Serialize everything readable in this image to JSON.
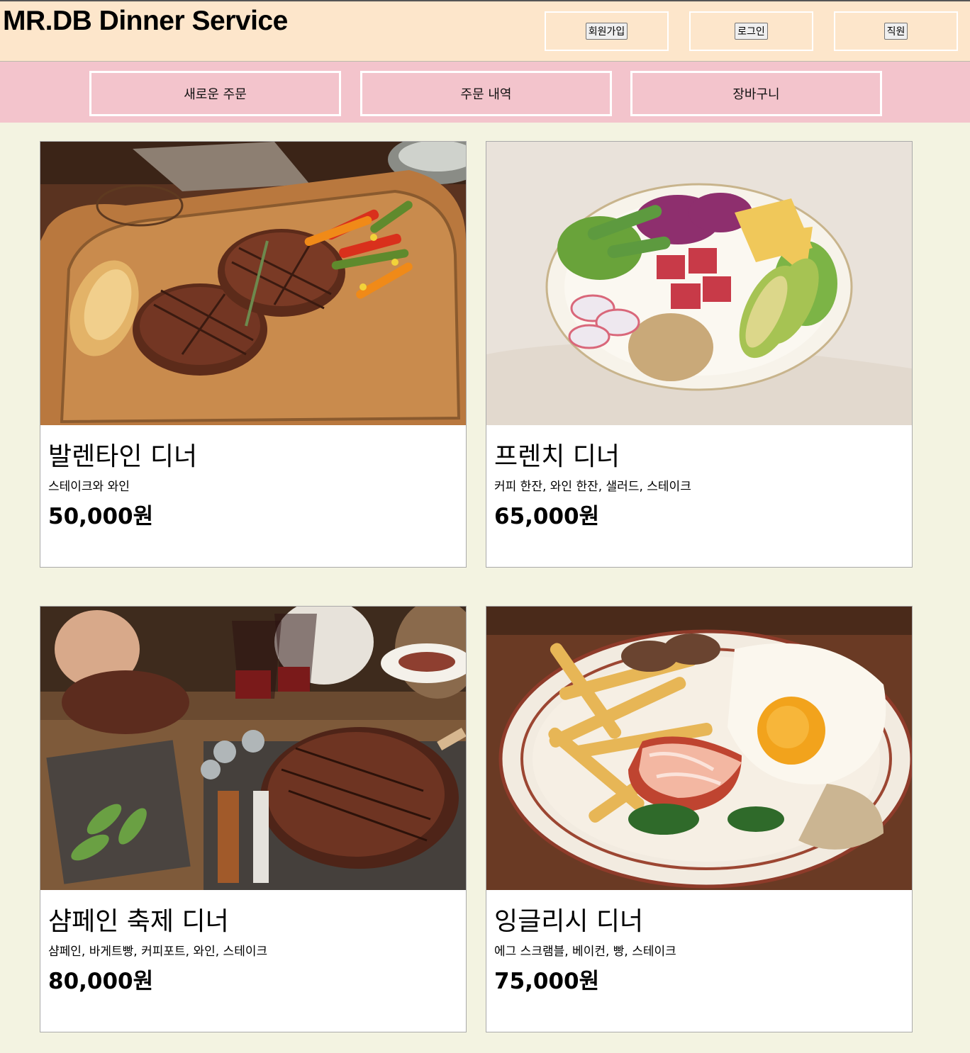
{
  "header": {
    "brand": "MR.DB Dinner Service",
    "auth_buttons": [
      "회원가입",
      "로그인",
      "직원"
    ]
  },
  "nav": {
    "items": [
      "새로운 주문",
      "주문 내역",
      "장바구니"
    ]
  },
  "menu": [
    {
      "name": "발렌타인 디너",
      "description": "스테이크와 와인",
      "price": "50,000원",
      "photo_icon": "steak-board-photo"
    },
    {
      "name": "프렌치 디너",
      "description": "커피 한잔, 와인 한잔, 샐러드, 스테이크",
      "price": "65,000원",
      "photo_icon": "salad-bowl-photo"
    },
    {
      "name": "샴페인 축제 디너",
      "description": "샴페인, 바게트빵, 커피포트, 와인, 스테이크",
      "price": "80,000원",
      "photo_icon": "feast-table-photo"
    },
    {
      "name": "잉글리시 디너",
      "description": "에그 스크램블, 베이컨, 빵, 스테이크",
      "price": "75,000원",
      "photo_icon": "english-breakfast-photo"
    }
  ],
  "colors": {
    "page_bg": "#f3f3e1",
    "topbar_bg": "#fde6cb",
    "navbar_bg": "#f3c4cc"
  }
}
